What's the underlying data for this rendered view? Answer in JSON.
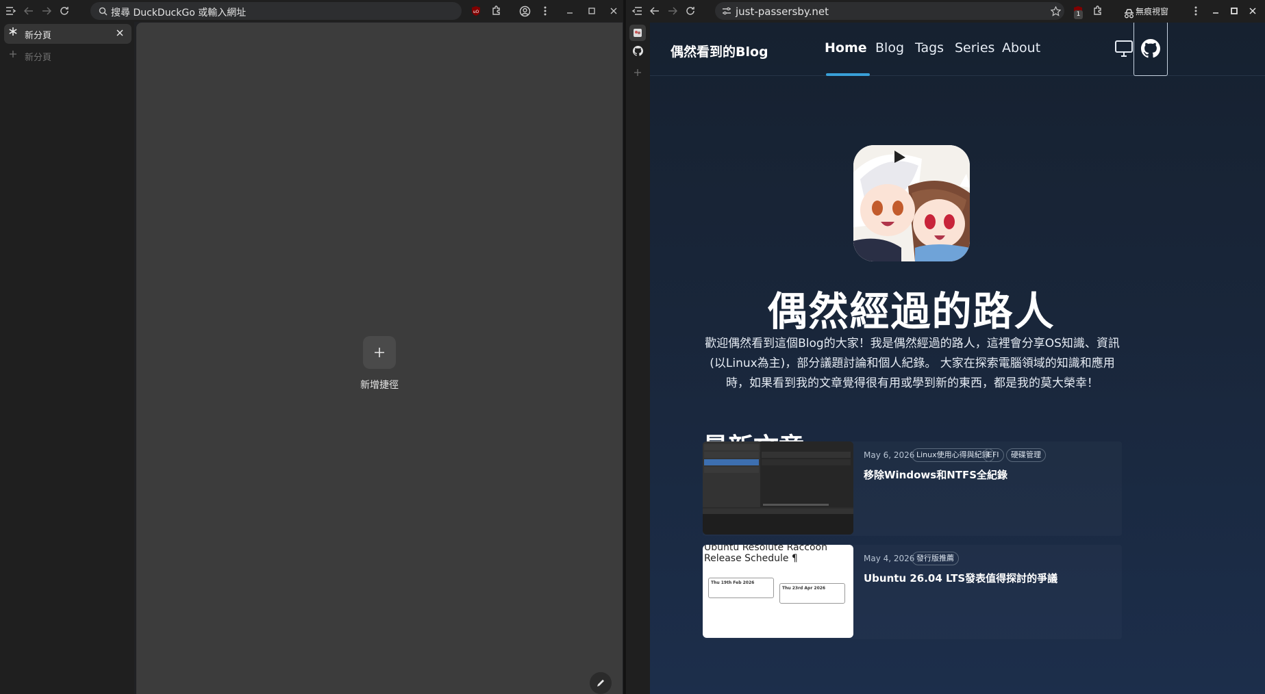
{
  "left_window": {
    "omnibox_placeholder": "搜尋 DuckDuckGo 或輸入網址",
    "tabs": [
      {
        "label": "新分頁",
        "active": true
      }
    ],
    "new_tab_label": "新分頁",
    "shortcut_label": "新增捷徑"
  },
  "right_window": {
    "url": "just-passersby.net",
    "extension_badge": "1",
    "incognito_label": "無痕視窗"
  },
  "blog": {
    "site_title": "偶然看到的Blog",
    "nav": [
      "Home",
      "Blog",
      "Tags",
      "Series",
      "About"
    ],
    "active_nav": "Home",
    "hero_title": "偶然經過的路人",
    "hero_description": "歡迎偶然看到這個Blog的大家！我是偶然經過的路人，這裡會分享OS知識、資訊(以Linux為主)，部分議題討論和個人紀錄。 大家在探索電腦領域的知識和應用時，如果看到我的文章覺得很有用或學到新的東西，都是我的莫大榮幸！",
    "section_title": "最新文章",
    "posts": [
      {
        "date": "May 6, 2026",
        "tags": [
          "Linux使用心得與紀錄",
          "EFI",
          "硬碟管理"
        ],
        "title": "移除Windows和NTFS全紀錄"
      },
      {
        "date": "May 4, 2026",
        "tags": [
          "發行版推薦"
        ],
        "title": "Ubuntu 26.04 LTS發表值得探討的爭議",
        "thumb_title": "Ubuntu Resolute Raccoon Release Schedule ¶",
        "thumb_cards": [
          "Thu 19th Feb 2026",
          "Thu 23rd Apr 2026"
        ]
      }
    ]
  }
}
